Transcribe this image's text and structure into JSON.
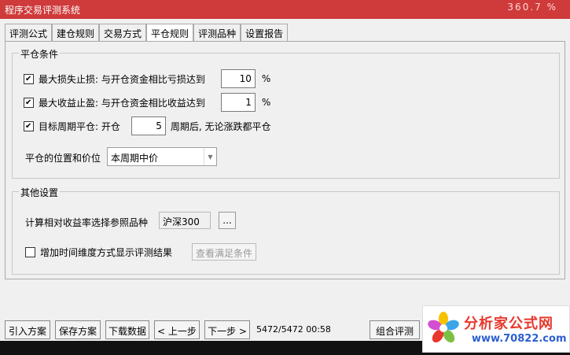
{
  "window": {
    "title": "程序交易评测系统",
    "ticker_fragment": "360.7 %"
  },
  "tabs": [
    {
      "label": "评测公式"
    },
    {
      "label": "建仓规则"
    },
    {
      "label": "交易方式"
    },
    {
      "label": "平仓规则",
      "active": true
    },
    {
      "label": "评测品种"
    },
    {
      "label": "设置报告"
    }
  ],
  "close_conditions": {
    "legend": "平仓条件",
    "max_loss": {
      "checked": true,
      "label": "最大损失止损: 与开仓资金相比亏损达到",
      "value": "10",
      "unit": "%"
    },
    "max_gain": {
      "checked": true,
      "label": "最大收益止盈: 与开仓资金相比收益达到",
      "value": "1",
      "unit": "%"
    },
    "target_period": {
      "checked": true,
      "label_before": "目标周期平仓: 开仓",
      "value": "5",
      "label_after": "周期后, 无论涨跌都平仓"
    },
    "position_price": {
      "label": "平仓的位置和价位",
      "selected": "本周期中价"
    }
  },
  "other_settings": {
    "legend": "其他设置",
    "reference": {
      "label": "计算相对收益率选择参照品种",
      "value": "沪深300",
      "browse_label": "..."
    },
    "time_dimension": {
      "checked": false,
      "label": "增加时间维度方式显示评测结果",
      "button_label": "查看满足条件"
    }
  },
  "bottom": {
    "import_label": "引入方案",
    "save_label": "保存方案",
    "download_label": "下载数据",
    "prev_label": "< 上一步",
    "next_label": "下一步 >",
    "status": "5472/5472 00:58",
    "combined_label": "组合评测"
  },
  "logo": {
    "brand": "分析家公式网",
    "url": "www.70822.com"
  },
  "colors": {
    "titlebar": "#cf3a3a",
    "brand_red": "#e8382c",
    "brand_blue": "#2c5fd0"
  }
}
